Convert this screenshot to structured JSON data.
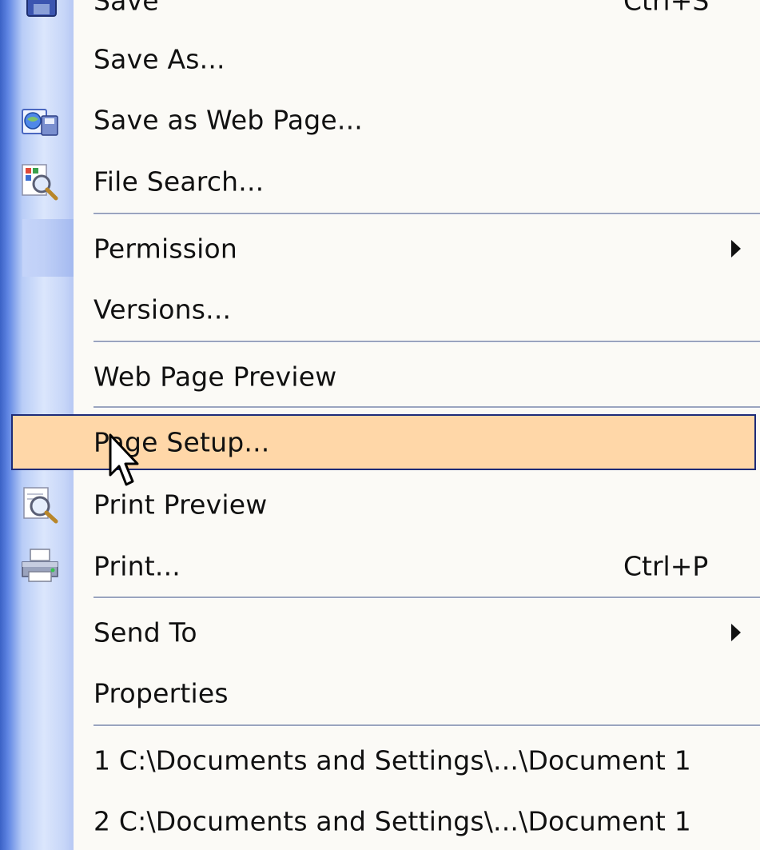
{
  "menu": {
    "items": [
      {
        "label": "Save",
        "shortcut": "Ctrl+S",
        "icon": "save-icon"
      },
      {
        "label": "Save As..."
      },
      {
        "label": "Save as Web Page...",
        "icon": "web-page-icon"
      },
      {
        "label": "File Search...",
        "icon": "file-search-icon"
      },
      {
        "label": "Permission",
        "submenu": true
      },
      {
        "label": "Versions..."
      },
      {
        "label": "Web Page Preview"
      },
      {
        "label": "Page Setup...",
        "selected": true
      },
      {
        "label": "Print Preview",
        "icon": "print-preview-icon"
      },
      {
        "label": "Print...",
        "shortcut": "Ctrl+P",
        "icon": "printer-icon"
      },
      {
        "label": "Send To",
        "submenu": true
      },
      {
        "label": "Properties"
      },
      {
        "label": "1 C:\\Documents and Settings\\...\\Document 1"
      },
      {
        "label": "2 C:\\Documents and Settings\\...\\Document 1"
      }
    ]
  },
  "colors": {
    "selected_bg": "#ffd7a8",
    "selected_border": "#1d2b78",
    "gutter_blue": "#5f85e3",
    "menu_bg": "#fbfaf6"
  }
}
